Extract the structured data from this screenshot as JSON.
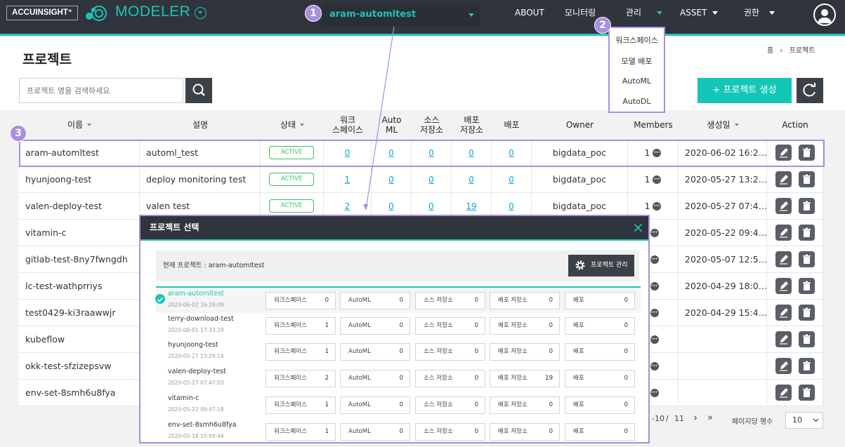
{
  "header": {
    "brand": "ACCUINSIGHT⁺",
    "app_name": "MODELER",
    "project_selector": "aram-automltest",
    "nav": {
      "about": "ABOUT",
      "monitoring": "모니터링",
      "admin": "관리",
      "asset": "ASSET",
      "permission": "권한"
    }
  },
  "admin_menu": [
    "워크스페이스",
    "모델 배포",
    "AutoML",
    "AutoDL"
  ],
  "markers": [
    "1",
    "2",
    "3"
  ],
  "page": {
    "title": "프로젝트",
    "breadcrumb": [
      "홈",
      "프로젝트"
    ],
    "search_placeholder": "프로젝트 명을 검색하세요",
    "create_button": "+ 프로젝트 생성"
  },
  "table": {
    "columns": {
      "name": "이름",
      "description": "설명",
      "status": "상태",
      "workspace": "워크\n스페이스",
      "automl": "Auto\nML",
      "source_storage": "소스\n저장소",
      "deploy_storage": "배포\n저장소",
      "deploy": "배포",
      "owner": "Owner",
      "members": "Members",
      "created": "생성일",
      "action": "Action"
    },
    "rows": [
      {
        "name": "aram-automltest",
        "desc": "automl_test",
        "status": "ACTIVE",
        "ws": "0",
        "aml": "0",
        "src": "0",
        "dst": "0",
        "dep": "0",
        "owner": "bigdata_poc",
        "members": "1",
        "created": "2020-06-02 16:2…"
      },
      {
        "name": "hyunjoong-test",
        "desc": "deploy monitoring test",
        "status": "ACTIVE",
        "ws": "1",
        "aml": "0",
        "src": "0",
        "dst": "0",
        "dep": "0",
        "owner": "bigdata_poc",
        "members": "1",
        "created": "2020-05-27 13:2…"
      },
      {
        "name": "valen-deploy-test",
        "desc": "valen test",
        "status": "ACTIVE",
        "ws": "2",
        "aml": "0",
        "src": "0",
        "dst": "19",
        "dep": "0",
        "owner": "bigdata_poc",
        "members": "1",
        "created": "2020-05-27 07:4…"
      },
      {
        "name": "vitamin-c",
        "created": "2020-05-22 09:4…"
      },
      {
        "name": "gitlab-test-8ny7fwngdh",
        "created": "2020-05-07 12:5…"
      },
      {
        "name": "lc-test-wathprriys",
        "created": "2020-04-29 18:0…"
      },
      {
        "name": "test0429-ki3raawwjr",
        "created": "2020-04-29 15:4…"
      },
      {
        "name": "kubeflow",
        "created": ""
      },
      {
        "name": "okk-test-sfzizepsvw",
        "created": ""
      },
      {
        "name": "env-set-8smh6u8fya",
        "created": ""
      }
    ]
  },
  "pagination": {
    "range": "-10",
    "separator": "/",
    "total": "11",
    "next": "›",
    "last": "»",
    "per_page_label": "페이지당 행수",
    "per_page_value": "10"
  },
  "modal": {
    "title": "프로젝트 선택",
    "close": "×",
    "current_label": "현재 프로젝트 : aram-automltest",
    "manage_button": "프로젝트 관리",
    "stat_labels": [
      "워크스페이스",
      "AutoML",
      "소스 저장소",
      "배포 저장소",
      "배포"
    ],
    "projects": [
      {
        "name": "aram-automltest",
        "date": "2020-06-02 16:28:09",
        "stats": [
          "0",
          "0",
          "0",
          "0",
          "0"
        ]
      },
      {
        "name": "terry-download-test",
        "date": "2020-06-01 17:33:29",
        "stats": [
          "1",
          "0",
          "0",
          "0",
          "0"
        ]
      },
      {
        "name": "hyunjoong-test",
        "date": "2020-05-27 13:29:14",
        "stats": [
          "1",
          "0",
          "0",
          "0",
          "0"
        ]
      },
      {
        "name": "valen-deploy-test",
        "date": "2020-05-27 07:47:03",
        "stats": [
          "2",
          "0",
          "0",
          "19",
          "0"
        ]
      },
      {
        "name": "vitamin-c",
        "date": "2020-05-22 09:47:18",
        "stats": [
          "1",
          "0",
          "0",
          "0",
          "0"
        ]
      },
      {
        "name": "env-set-8smh6u8fya",
        "date": "2020-05-18 15:09:44",
        "stats": [
          "1",
          "0",
          "0",
          "0",
          "0"
        ]
      }
    ]
  },
  "colors": {
    "accent": "#1dc4b4",
    "nav_bg": "#30343c",
    "highlight": "#a98ee0",
    "active_badge": "#3cbf5a",
    "link": "#14a4d8"
  }
}
